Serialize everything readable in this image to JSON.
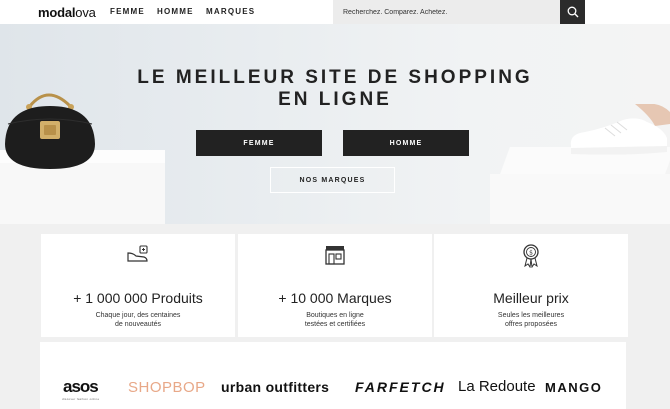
{
  "header": {
    "logo_main": "modal",
    "logo_thin": "ova",
    "nav": [
      "FEMME",
      "HOMME",
      "MARQUES"
    ],
    "search": {
      "placeholder": "Recherchez. Comparez. Achetez."
    }
  },
  "hero": {
    "title_line1": "LE MEILLEUR SITE DE SHOPPING",
    "title_line2": "EN LIGNE",
    "btn_femme": "FEMME",
    "btn_homme": "HOMME",
    "btn_marques": "NOS MARQUES"
  },
  "features": [
    {
      "icon": "shoe-tag-icon",
      "title": "+ 1 000 000 Produits",
      "sub1": "Chaque jour, des centaines",
      "sub2": "de nouveautés"
    },
    {
      "icon": "storefront-icon",
      "title": "+ 10 000 Marques",
      "sub1": "Boutiques en ligne",
      "sub2": "testées et certifiées"
    },
    {
      "icon": "dollar-medal-icon",
      "title": "Meilleur prix",
      "sub1": "Seules les meilleures",
      "sub2": "offres proposées"
    }
  ],
  "brands": {
    "asos": "asos",
    "asos_sub": "discover fashion online",
    "shopbop": "SHOPBOP",
    "urban": "urban outfitters",
    "farfetch": "FARFETCH",
    "laredoute": "La Redoute",
    "mango": "MANGO"
  },
  "colors": {
    "accent_dark": "#222222",
    "shopbop": "#e8a888",
    "hero_bg": "#e5eaee"
  }
}
